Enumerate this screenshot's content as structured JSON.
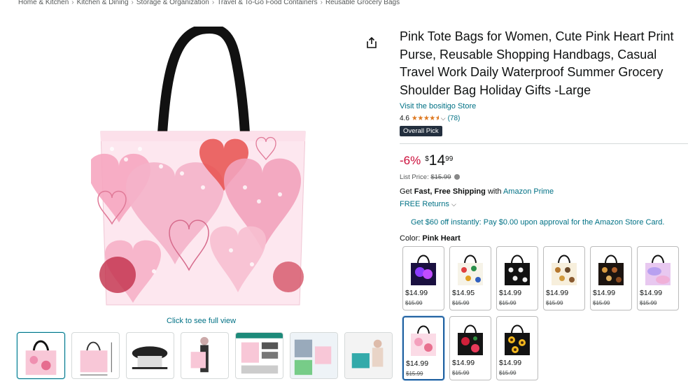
{
  "breadcrumb": [
    "Home & Kitchen",
    "Kitchen & Dining",
    "Storage & Organization",
    "Travel & To-Go Food Containers",
    "Reusable Grocery Bags"
  ],
  "breadcrumb_separator": "›",
  "product": {
    "title": "Pink Tote Bags for Women, Cute Pink Heart Print Purse, Reusable Shopping Handbags, Casual Travel Work Daily Waterproof Summer Grocery Shoulder Bag Holiday Gifts -Large",
    "store_link": "Visit the bositigo Store",
    "rating_value": "4.6",
    "rating_stars": 4.6,
    "rating_count": "(78)",
    "badge": "Overall Pick"
  },
  "price": {
    "discount": "-6%",
    "currency": "$",
    "whole": "14",
    "fraction": "99",
    "list_price_label": "List Price:",
    "list_price": "$15.99"
  },
  "shipping": {
    "get": "Get",
    "fast_free": "Fast, Free Shipping",
    "with": "with",
    "prime": "Amazon Prime",
    "returns": "FREE Returns"
  },
  "promo": "Get $60 off instantly: Pay $0.00 upon approval for the Amazon Store Card.",
  "color": {
    "label": "Color:",
    "selected": "Pink Heart",
    "options": [
      {
        "price": "$14.99",
        "list": "$15.99",
        "pattern": "butterfly-purple"
      },
      {
        "price": "$14.95",
        "list": "$15.99",
        "pattern": "floral-white"
      },
      {
        "price": "$14.99",
        "list": "$15.99",
        "pattern": "skull-black"
      },
      {
        "price": "$14.99",
        "list": "$15.99",
        "pattern": "owl-cream"
      },
      {
        "price": "$14.99",
        "list": "$15.99",
        "pattern": "owl-black"
      },
      {
        "price": "$14.99",
        "list": "$15.99",
        "pattern": "pastel-marble"
      },
      {
        "price": "$14.99",
        "list": "$15.99",
        "pattern": "pink-heart",
        "selected": true
      },
      {
        "price": "$14.99",
        "list": "$15.99",
        "pattern": "red-rose-black"
      },
      {
        "price": "$14.99",
        "list": "$15.99",
        "pattern": "sunflower-black"
      }
    ]
  },
  "gallery": {
    "full_view": "Click to see full view",
    "thumbnail_count": 8,
    "selected_index": 0
  },
  "icons": {
    "share": "share-icon",
    "rating_dropdown": "chevron-down-icon",
    "returns_dropdown": "chevron-down-icon",
    "info": "info-icon"
  },
  "colors": {
    "link": "#007185",
    "discount": "#CC0C39",
    "star": "#DE7921",
    "badge_bg": "#232F3E",
    "selected_swatch": "#2162a1"
  }
}
